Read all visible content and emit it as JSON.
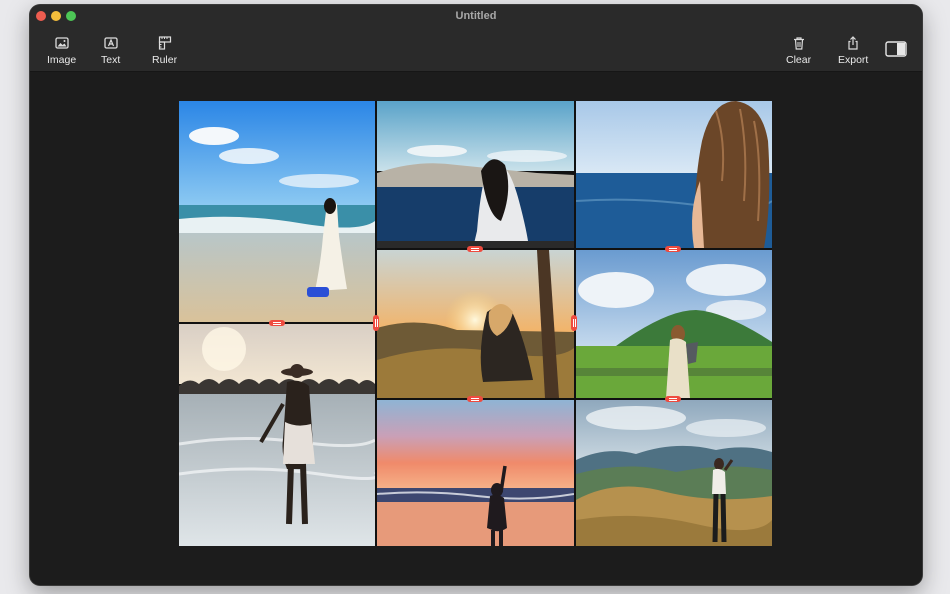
{
  "window": {
    "title": "Untitled"
  },
  "toolbar": {
    "image_label": "Image",
    "text_label": "Text",
    "ruler_label": "Ruler",
    "clear_label": "Clear",
    "export_label": "Export"
  },
  "icons": {
    "image": "image-icon",
    "text": "text-box-icon",
    "ruler": "ruler-icon",
    "clear": "trash-icon",
    "export": "share-icon",
    "sidebar": "sidebar-toggle-icon"
  },
  "colors": {
    "handle": "#ef4b3f",
    "close": "#ee5d50",
    "minimize": "#f5be3c",
    "zoom": "#4dc656"
  }
}
